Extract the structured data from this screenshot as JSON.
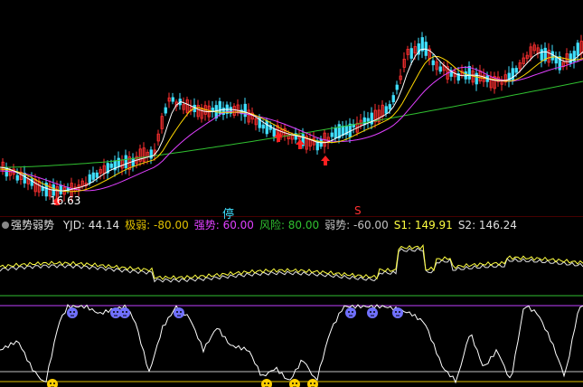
{
  "main_chart": {
    "low_label": "16.63",
    "halt_marker": "停",
    "s_marker": "S",
    "colors": {
      "up": "#ff3030",
      "down": "#40e0ff",
      "ma5": "#ffffff",
      "ma10": "#ffd700",
      "ma20": "#e040ff",
      "ma60": "#30c030",
      "arrow": "#ff2020"
    }
  },
  "indicator_bar": {
    "name": "强势弱势",
    "items": [
      {
        "label": "YJD:",
        "value": "44.14",
        "color": "#e0e0e0"
      },
      {
        "label": "极弱:",
        "value": "-80.00",
        "color": "#e0c000"
      },
      {
        "label": "强势:",
        "value": "60.00",
        "color": "#e040ff"
      },
      {
        "label": "风险:",
        "value": "80.00",
        "color": "#30c030"
      },
      {
        "label": "弱势:",
        "value": "-60.00",
        "color": "#c0c0c0"
      },
      {
        "label": "S1:",
        "value": "149.91",
        "color": "#ffff40"
      },
      {
        "label": "S2:",
        "value": "146.24",
        "color": "#e0e0e0"
      }
    ]
  },
  "sub_chart": {
    "colors": {
      "line": "#ffffff",
      "upper": "#c040ff",
      "lower": "#e0c000",
      "mid": "#30c030",
      "weak_icon": "#7070ff",
      "strong_icon": "#ffd000"
    }
  }
}
